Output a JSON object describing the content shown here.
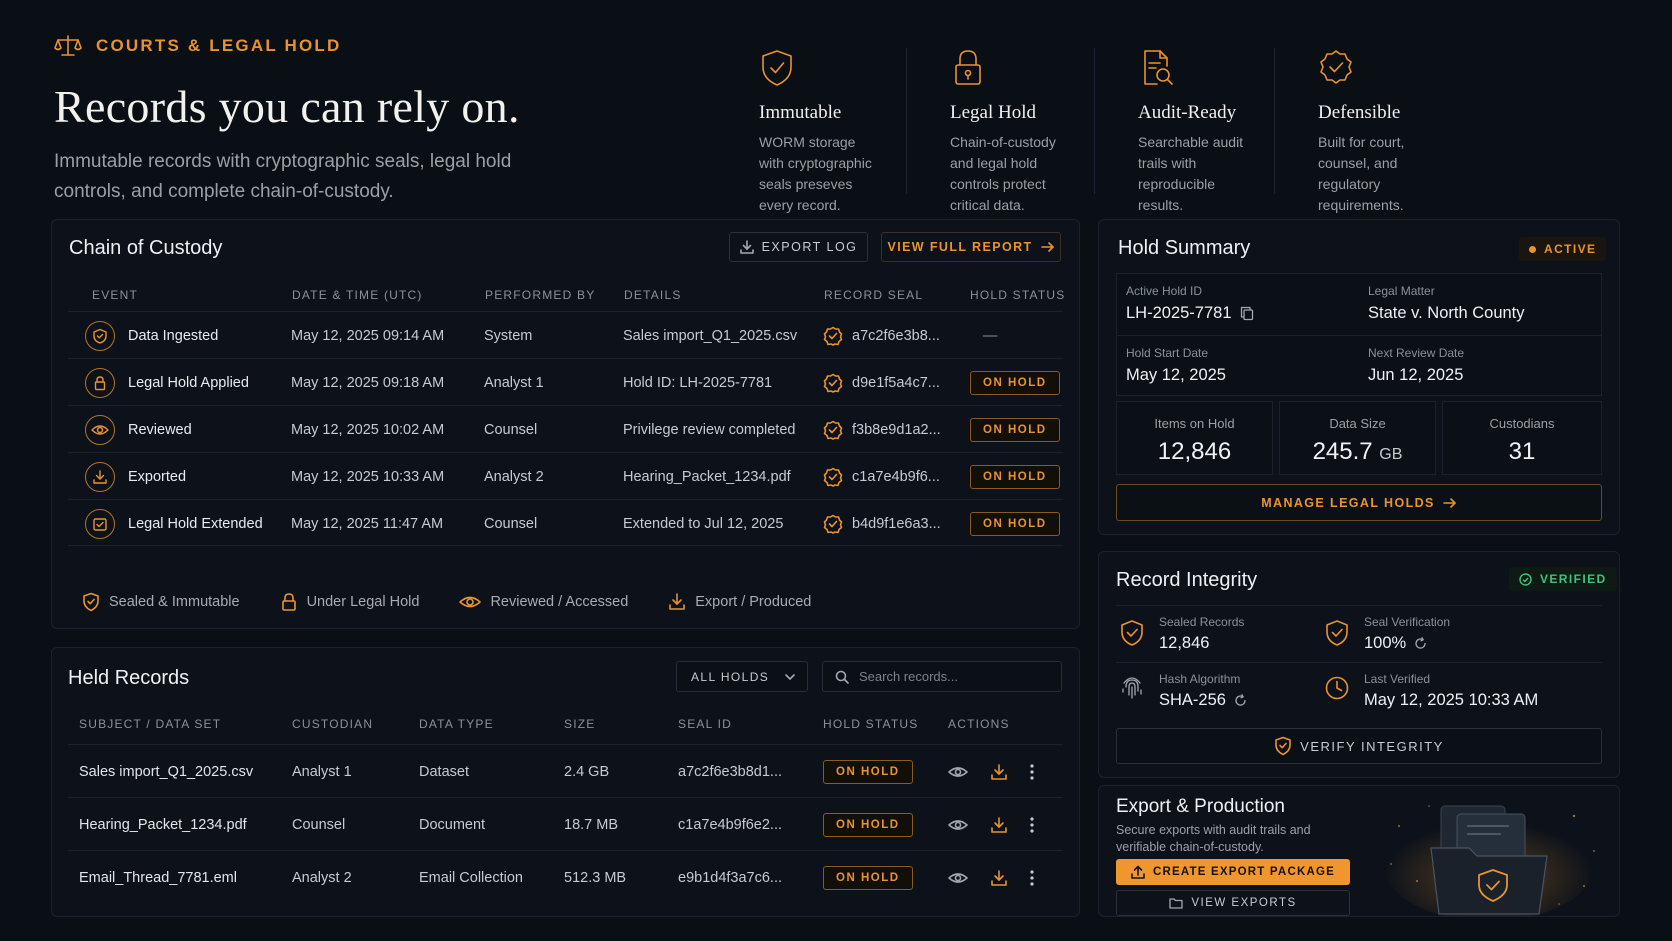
{
  "hero": {
    "eyebrow": "COURTS & LEGAL HOLD",
    "title": "Records you can rely on.",
    "subtitle": "Immutable records with cryptographic seals, legal hold controls, and complete chain-of-custody."
  },
  "features": [
    {
      "icon": "shield-check-icon",
      "title": "Immutable",
      "text": "WORM storage with cryptographic seals preseves every record."
    },
    {
      "icon": "padlock-icon",
      "title": "Legal Hold",
      "text": "Chain-of-custody and legal hold controls protect critical data."
    },
    {
      "icon": "document-search-icon",
      "title": "Audit-Ready",
      "text": "Searchable audit trails with reproducible results."
    },
    {
      "icon": "seal-badge-icon",
      "title": "Defensible",
      "text": "Built for court, counsel, and regulatory requirements."
    }
  ],
  "custody": {
    "title": "Chain of Custody",
    "export_label": "EXPORT LOG",
    "report_label": "VIEW FULL REPORT",
    "columns": [
      "EVENT",
      "DATE & TIME (UTC)",
      "PERFORMED BY",
      "DETAILS",
      "RECORD SEAL",
      "HOLD STATUS"
    ],
    "rows": [
      {
        "event": "Data Ingested",
        "icon": "shield-icon",
        "datetime": "May 12, 2025 09:14 AM",
        "by": "System",
        "details": "Sales import_Q1_2025.csv",
        "seal": "a7c2f6e3b8...",
        "status": "—"
      },
      {
        "event": "Legal Hold Applied",
        "icon": "lock-icon",
        "datetime": "May 12, 2025 09:18 AM",
        "by": "Analyst 1",
        "details": "Hold ID: LH-2025-7781",
        "seal": "d9e1f5a4c7...",
        "status": "ON HOLD"
      },
      {
        "event": "Reviewed",
        "icon": "eye-icon",
        "datetime": "May 12, 2025 10:02 AM",
        "by": "Counsel",
        "details": "Privilege review completed",
        "seal": "f3b8e9d1a2...",
        "status": "ON HOLD"
      },
      {
        "event": "Exported",
        "icon": "download-icon",
        "datetime": "May 12, 2025 10:33 AM",
        "by": "Analyst 2",
        "details": "Hearing_Packet_1234.pdf",
        "seal": "c1a7e4b9f6...",
        "status": "ON HOLD"
      },
      {
        "event": "Legal Hold Extended",
        "icon": "calendar-check-icon",
        "datetime": "May 12, 2025 11:47 AM",
        "by": "Counsel",
        "details": "Extended to Jul 12, 2025",
        "seal": "b4d9f1e6a3...",
        "status": "ON HOLD"
      }
    ],
    "legend": [
      "Sealed & Immutable",
      "Under Legal Hold",
      "Reviewed / Accessed",
      "Export / Produced"
    ]
  },
  "held": {
    "title": "Held Records",
    "filter": "ALL HOLDS",
    "search_placeholder": "Search records...",
    "columns": [
      "SUBJECT / DATA SET",
      "CUSTODIAN",
      "DATA TYPE",
      "SIZE",
      "SEAL ID",
      "HOLD STATUS",
      "ACTIONS"
    ],
    "rows": [
      {
        "subject": "Sales import_Q1_2025.csv",
        "custodian": "Analyst 1",
        "type": "Dataset",
        "size": "2.4 GB",
        "seal": "a7c2f6e3b8d1...",
        "status": "ON HOLD"
      },
      {
        "subject": "Hearing_Packet_1234.pdf",
        "custodian": "Counsel",
        "type": "Document",
        "size": "18.7 MB",
        "seal": "c1a7e4b9f6e2...",
        "status": "ON HOLD"
      },
      {
        "subject": "Email_Thread_7781.eml",
        "custodian": "Analyst 2",
        "type": "Email Collection",
        "size": "512.3 MB",
        "seal": "e9b1d4f3a7c6...",
        "status": "ON HOLD"
      }
    ]
  },
  "summary": {
    "title": "Hold Summary",
    "status": "ACTIVE",
    "hold_id_label": "Active Hold ID",
    "hold_id": "LH-2025-7781",
    "matter_label": "Legal Matter",
    "matter": "State v. North County",
    "start_label": "Hold Start Date",
    "start": "May 12, 2025",
    "review_label": "Next Review Date",
    "review": "Jun 12, 2025",
    "items_label": "Items on Hold",
    "items": "12,846",
    "size_label": "Data Size",
    "size": "245.7",
    "size_unit": "GB",
    "custodians_label": "Custodians",
    "custodians": "31",
    "manage_label": "MANAGE LEGAL HOLDS"
  },
  "integrity": {
    "title": "Record Integrity",
    "status": "VERIFIED",
    "sealed_label": "Sealed Records",
    "sealed": "12,846",
    "verif_label": "Seal Verification",
    "verif": "100%",
    "hash_label": "Hash Algorithm",
    "hash": "SHA-256",
    "last_label": "Last Verified",
    "last": "May 12, 2025 10:33 AM",
    "verify_label": "VERIFY INTEGRITY"
  },
  "export": {
    "title": "Export & Production",
    "text": "Secure exports with audit trails and verifiable chain-of-custody.",
    "create_label": "CREATE EXPORT PACKAGE",
    "view_label": "VIEW EXPORTS"
  },
  "colors": {
    "accent": "#e9932f",
    "success": "#3ec47a",
    "background": "#0a0e15",
    "panel": "#0d121a"
  }
}
